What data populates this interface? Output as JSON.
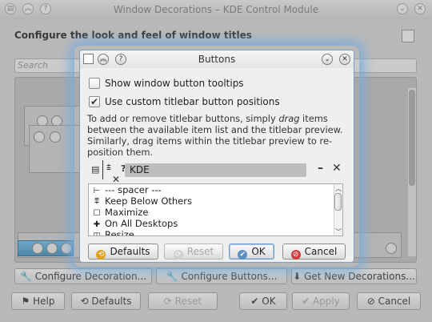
{
  "background_window": {
    "title": "Window Decorations – KDE Control Module",
    "heading": "Configure the look and feel of window titles",
    "search_placeholder": "Search",
    "buttons_row": {
      "configure_decoration": "Configure Decoration...",
      "configure_buttons": "Configure Buttons...",
      "get_new_decorations": "Get New Decorations..."
    },
    "footer": {
      "help": "Help",
      "defaults": "Defaults",
      "reset": "Reset",
      "ok": "OK",
      "apply": "Apply",
      "cancel": "Cancel"
    }
  },
  "dialog": {
    "title": "Buttons",
    "show_tooltips": {
      "label": "Show window button tooltips",
      "checked": false
    },
    "custom_positions": {
      "label": "Use custom titlebar button positions",
      "checked": true
    },
    "description_prefix": "To add or remove titlebar buttons, simply ",
    "description_em": "drag",
    "description_suffix": " items between the available item list and the titlebar preview. Similarly, drag items within the titlebar preview to re-position them.",
    "preview": {
      "left_icons": [
        "menu-icon",
        "on-all-desktops-icon",
        "help-icon"
      ],
      "title_text": "KDE",
      "right_icons": [
        "minimize-icon",
        "close-icon"
      ]
    },
    "items": [
      {
        "icon": "spacer-icon",
        "label": "--- spacer ---"
      },
      {
        "icon": "keep-below-icon",
        "label": "Keep Below Others"
      },
      {
        "icon": "maximize-icon",
        "label": "Maximize"
      },
      {
        "icon": "on-all-desktops-icon",
        "label": "On All Desktops"
      },
      {
        "icon": "resize-icon",
        "label": "Resize"
      }
    ],
    "buttons": {
      "defaults": "Defaults",
      "reset": "Reset",
      "ok": "OK",
      "cancel": "Cancel"
    }
  },
  "colors": {
    "accent_glow": "#78aadc",
    "dialog_bg": "#efefef",
    "dimmed_bg": "#b9b9b9"
  }
}
